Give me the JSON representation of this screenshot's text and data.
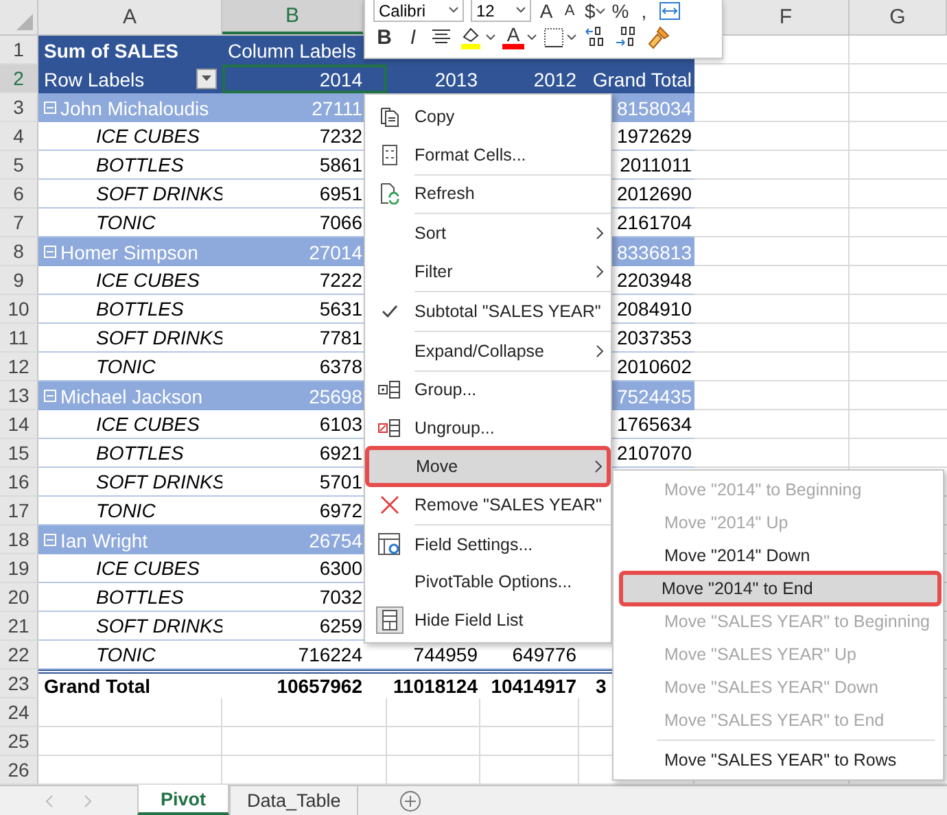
{
  "toolbar": {
    "font": "Calibri",
    "size": "12",
    "top_buttons": [
      {
        "kind": "grow",
        "label": "A"
      },
      {
        "kind": "shrink",
        "label": "A"
      },
      {
        "kind": "currency",
        "label": "$"
      },
      {
        "kind": "percent",
        "label": "%"
      },
      {
        "kind": "comma",
        "label": ","
      },
      {
        "kind": "wrap"
      }
    ],
    "bottom_buttons": [
      {
        "kind": "bold",
        "label": "B"
      },
      {
        "kind": "italic",
        "label": "I"
      },
      {
        "kind": "center"
      },
      {
        "kind": "fill",
        "color": "#ffff00"
      },
      {
        "kind": "fontcolor",
        "label": "A",
        "color": "#ff0000"
      },
      {
        "kind": "borders"
      },
      {
        "kind": "inc_decimal"
      },
      {
        "kind": "dec_decimal"
      },
      {
        "kind": "painter"
      }
    ]
  },
  "column_headers": [
    {
      "label": "A",
      "selected": false
    },
    {
      "label": "B",
      "selected": true
    },
    {
      "label": "F",
      "selected": false
    },
    {
      "label": "G",
      "selected": false
    }
  ],
  "rows": [
    {
      "number": "1",
      "kind": "title",
      "selected": false,
      "a": "Sum of SALES",
      "b": "Column Labels"
    },
    {
      "number": "2",
      "kind": "labels",
      "selected": true,
      "a": "Row Labels",
      "b": "2014",
      "c": "2013",
      "d": "2012",
      "e": "Grand Total"
    },
    {
      "number": "3",
      "kind": "group",
      "selected": false,
      "expanded": true,
      "a": "John Michaloudis",
      "b": "27111",
      "e": "8158034"
    },
    {
      "number": "4",
      "kind": "item",
      "selected": false,
      "a": "ICE CUBES",
      "b": "7232",
      "e": "1972629"
    },
    {
      "number": "5",
      "kind": "item",
      "selected": false,
      "a": "BOTTLES",
      "b": "5861",
      "e": "2011011"
    },
    {
      "number": "6",
      "kind": "item",
      "selected": false,
      "a": "SOFT DRINKS",
      "b": "6951",
      "e": "2012690"
    },
    {
      "number": "7",
      "kind": "item",
      "selected": false,
      "a": "TONIC",
      "b": "7066",
      "e": "2161704"
    },
    {
      "number": "8",
      "kind": "group",
      "selected": false,
      "expanded": true,
      "a": "Homer Simpson",
      "b": "27014",
      "e": "8336813"
    },
    {
      "number": "9",
      "kind": "item",
      "selected": false,
      "a": "ICE CUBES",
      "b": "7222",
      "e": "2203948"
    },
    {
      "number": "10",
      "kind": "item",
      "selected": false,
      "a": "BOTTLES",
      "b": "5631",
      "e": "2084910"
    },
    {
      "number": "11",
      "kind": "item",
      "selected": false,
      "a": "SOFT DRINKS",
      "b": "7781",
      "e": "2037353"
    },
    {
      "number": "12",
      "kind": "item",
      "selected": false,
      "a": "TONIC",
      "b": "6378",
      "e": "2010602"
    },
    {
      "number": "13",
      "kind": "group",
      "selected": false,
      "expanded": true,
      "a": "Michael Jackson",
      "b": "25698",
      "e": "7524435"
    },
    {
      "number": "14",
      "kind": "item",
      "selected": false,
      "a": "ICE CUBES",
      "b": "6103",
      "e": "1765634"
    },
    {
      "number": "15",
      "kind": "item",
      "selected": false,
      "a": "BOTTLES",
      "b": "6921",
      "e": "2107070"
    },
    {
      "number": "16",
      "kind": "item",
      "selected": false,
      "a": "SOFT DRINKS",
      "b": "5701"
    },
    {
      "number": "17",
      "kind": "item",
      "selected": false,
      "a": "TONIC",
      "b": "6972"
    },
    {
      "number": "18",
      "kind": "group",
      "selected": false,
      "expanded": true,
      "a": "Ian Wright",
      "b": "26754"
    },
    {
      "number": "19",
      "kind": "item",
      "selected": false,
      "a": "ICE CUBES",
      "b": "6300"
    },
    {
      "number": "20",
      "kind": "item",
      "selected": false,
      "a": "BOTTLES",
      "b": "7032"
    },
    {
      "number": "21",
      "kind": "item",
      "selected": false,
      "a": "SOFT DRINKS",
      "b": "6259"
    },
    {
      "number": "22",
      "kind": "item",
      "selected": false,
      "a": "TONIC",
      "b": "716224",
      "c": "744959",
      "d": "649776"
    },
    {
      "number": "23",
      "kind": "total",
      "selected": false,
      "a": "Grand Total",
      "b": "10657962",
      "c": "11018124",
      "d": "10414917",
      "e": "3"
    },
    {
      "number": "24",
      "kind": "empty",
      "selected": false
    },
    {
      "number": "25",
      "kind": "empty",
      "selected": false
    },
    {
      "number": "26",
      "kind": "empty",
      "selected": false
    }
  ],
  "context_menu": {
    "sections": [
      [
        {
          "label": "Copy",
          "checked": false,
          "submenu": false,
          "highlighted": false
        },
        {
          "label": "Format Cells...",
          "checked": false,
          "submenu": false,
          "highlighted": false
        }
      ],
      [
        {
          "label": "Refresh",
          "checked": false,
          "submenu": false,
          "highlighted": false
        }
      ],
      [
        {
          "label": "Sort",
          "checked": false,
          "submenu": true,
          "highlighted": false
        },
        {
          "label": "Filter",
          "checked": false,
          "submenu": true,
          "highlighted": false
        }
      ],
      [
        {
          "label": "Subtotal \"SALES YEAR\"",
          "checked": true,
          "submenu": false,
          "highlighted": false
        }
      ],
      [
        {
          "label": "Expand/Collapse",
          "checked": false,
          "submenu": true,
          "highlighted": false
        }
      ],
      [
        {
          "label": "Group...",
          "checked": false,
          "submenu": false,
          "highlighted": false
        },
        {
          "label": "Ungroup...",
          "checked": false,
          "submenu": false,
          "highlighted": false
        },
        {
          "label": "Move",
          "checked": false,
          "submenu": true,
          "highlighted": true
        },
        {
          "label": "Remove \"SALES YEAR\"",
          "checked": false,
          "submenu": false,
          "highlighted": false
        }
      ],
      [
        {
          "label": "Field Settings...",
          "checked": false,
          "submenu": false,
          "highlighted": false
        },
        {
          "label": "PivotTable Options...",
          "checked": false,
          "submenu": false,
          "highlighted": false
        },
        {
          "label": "Hide Field List",
          "checked": false,
          "submenu": false,
          "highlighted": false
        }
      ]
    ]
  },
  "submenu": {
    "sections": [
      [
        {
          "label": "Move \"2014\" to Beginning",
          "disabled": true,
          "highlighted": false
        },
        {
          "label": "Move \"2014\" Up",
          "disabled": true,
          "highlighted": false
        },
        {
          "label": "Move \"2014\" Down",
          "disabled": false,
          "highlighted": false
        },
        {
          "label": "Move \"2014\" to End",
          "disabled": false,
          "highlighted": true
        },
        {
          "label": "Move \"SALES YEAR\" to Beginning",
          "disabled": true,
          "highlighted": false
        },
        {
          "label": "Move \"SALES YEAR\" Up",
          "disabled": true,
          "highlighted": false
        },
        {
          "label": "Move \"SALES YEAR\" Down",
          "disabled": true,
          "highlighted": false
        },
        {
          "label": "Move \"SALES YEAR\" to End",
          "disabled": true,
          "highlighted": false
        }
      ],
      [
        {
          "label": "Move \"SALES YEAR\" to Rows",
          "disabled": false,
          "highlighted": false
        }
      ]
    ]
  },
  "sheet_tabs": [
    {
      "label": "Pivot",
      "selected": true
    },
    {
      "label": "Data_Table",
      "selected": false
    }
  ]
}
